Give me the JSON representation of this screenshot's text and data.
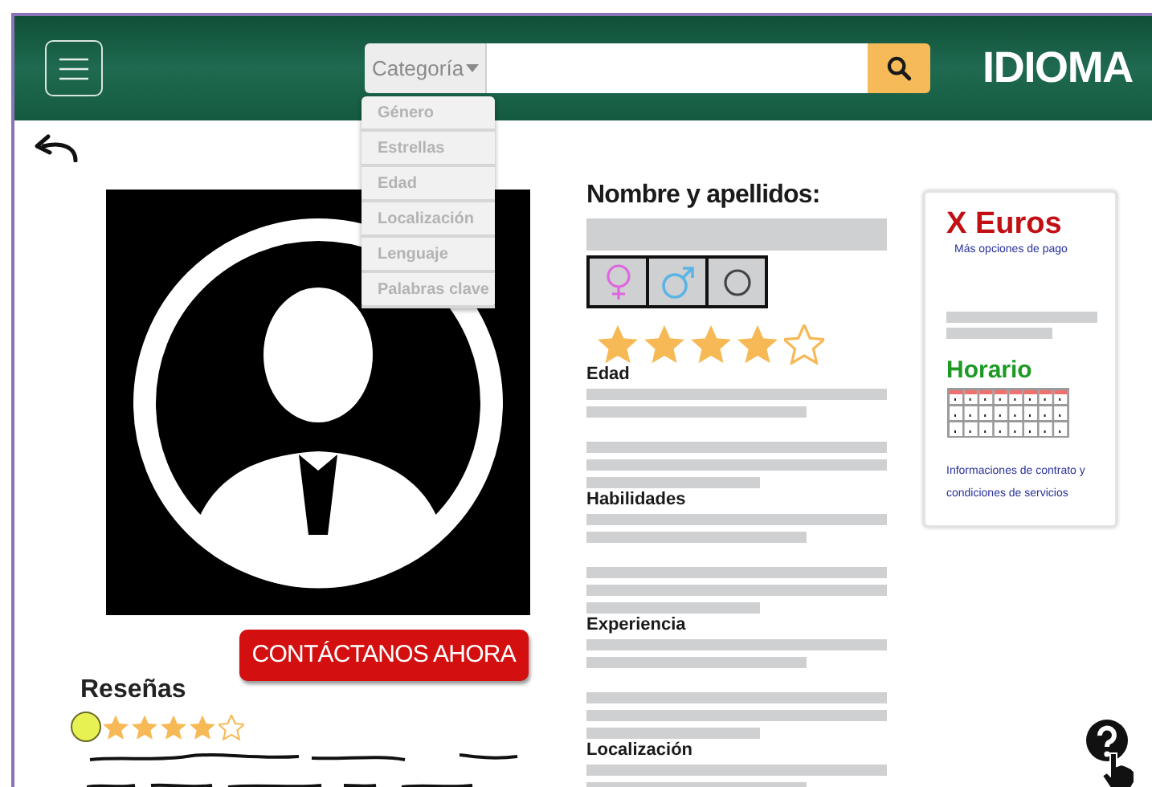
{
  "header": {
    "brand": "IDIOMA",
    "search": {
      "category": "Categoría",
      "dropdown_items": [
        {
          "label": "Género"
        },
        {
          "label": "Estrellas"
        },
        {
          "label": "Edad"
        },
        {
          "label": "Localización"
        },
        {
          "label": "Lenguaje"
        },
        {
          "label": "Palabras clave"
        }
      ]
    }
  },
  "profile": {
    "contact_button": "CONTÁCTANOS AHORA",
    "reviews": {
      "title": "Reseñas",
      "stars": 4
    }
  },
  "details": {
    "name_label": "Nombre y apellidos:",
    "stars": 4,
    "sections": [
      {
        "title": "Edad"
      },
      {
        "title": "Habilidades"
      },
      {
        "title": "Experiencia"
      },
      {
        "title": "Localización"
      }
    ]
  },
  "price_card": {
    "price": "X Euros",
    "payment_link": "Más opciones de pago",
    "schedule_title": "Horario",
    "contract_link": "Informaciones de contrato y condiciones de servicios"
  }
}
